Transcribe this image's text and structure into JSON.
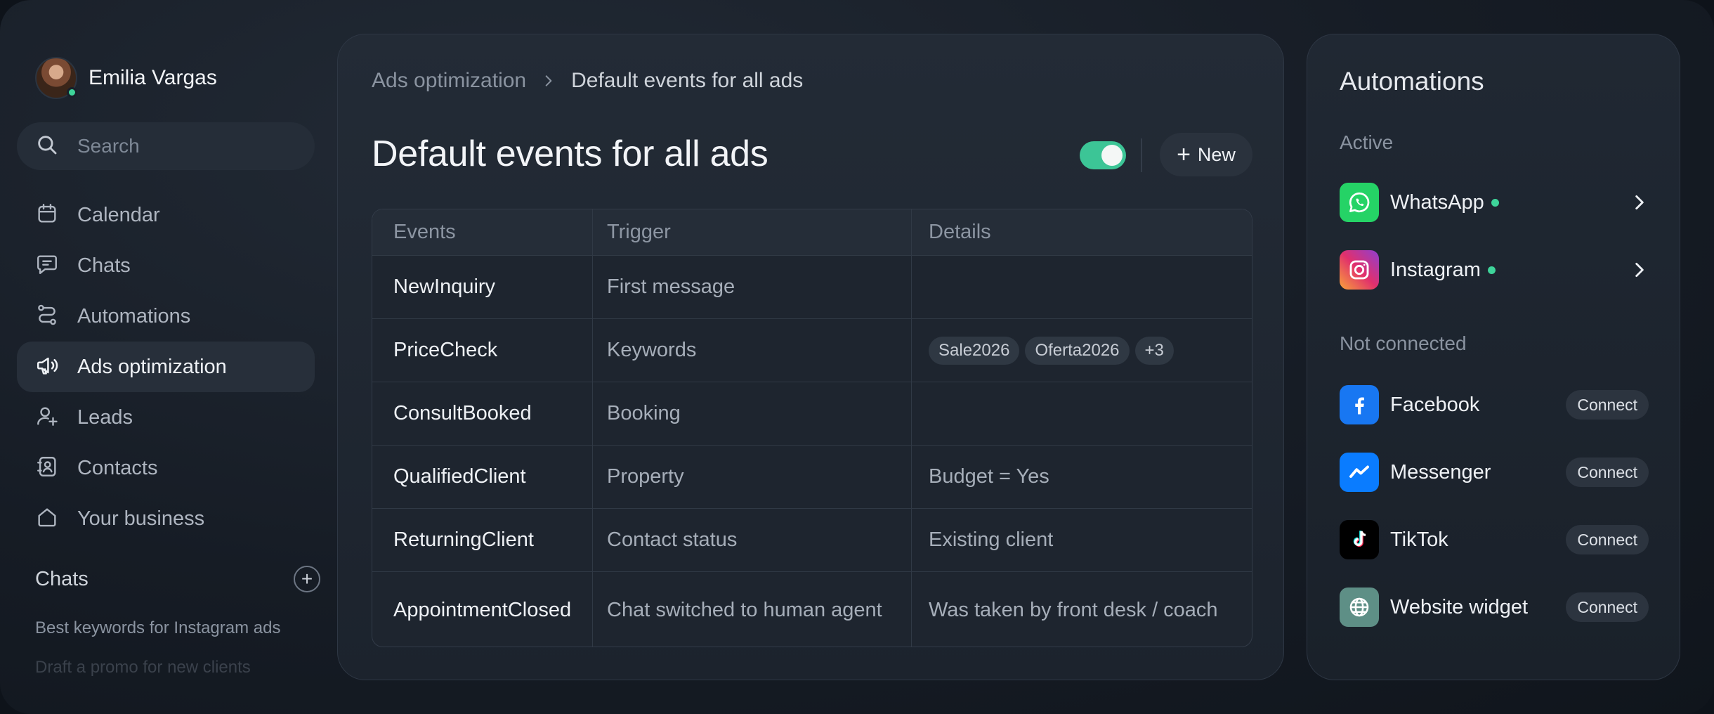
{
  "user": {
    "name": "Emilia Vargas"
  },
  "search": {
    "placeholder": "Search"
  },
  "nav": [
    {
      "label": "Calendar",
      "icon": "calendar-icon"
    },
    {
      "label": "Chats",
      "icon": "chat-icon"
    },
    {
      "label": "Automations",
      "icon": "automation-icon"
    },
    {
      "label": "Ads optimization",
      "icon": "megaphone-icon",
      "active": true
    },
    {
      "label": "Leads",
      "icon": "add-user-icon"
    },
    {
      "label": "Contacts",
      "icon": "contacts-icon"
    },
    {
      "label": "Your business",
      "icon": "home-icon"
    }
  ],
  "chats": {
    "title": "Chats",
    "items": [
      "Best keywords for Instagram ads",
      "Draft a promo for new clients"
    ]
  },
  "main": {
    "breadcrumb": [
      "Ads optimization",
      "Default events for all ads"
    ],
    "title": "Default events for all ads",
    "toggle_on": true,
    "new_label": "New",
    "table": {
      "headers": [
        "Events",
        "Trigger",
        "Details"
      ],
      "rows": [
        {
          "event": "NewInquiry",
          "trigger": "First message",
          "details": ""
        },
        {
          "event": "PriceCheck",
          "trigger": "Keywords",
          "tags": [
            "Sale2026",
            "Oferta2026",
            "+3"
          ]
        },
        {
          "event": "ConsultBooked",
          "trigger": "Booking",
          "details": ""
        },
        {
          "event": "QualifiedClient",
          "trigger": "Property",
          "details": "Budget = Yes"
        },
        {
          "event": "ReturningClient",
          "trigger": "Contact status",
          "details": "Existing client"
        },
        {
          "event": "AppointmentClosed",
          "trigger": "Chat switched to human agent",
          "details": "Was taken by front desk / coach"
        }
      ]
    }
  },
  "automations": {
    "title": "Automations",
    "active_label": "Active",
    "active": [
      {
        "name": "WhatsApp",
        "icon": "whatsapp-icon",
        "color": "#25d366"
      },
      {
        "name": "Instagram",
        "icon": "instagram-icon",
        "color": "#e1306c"
      }
    ],
    "not_connected_label": "Not connected",
    "connect_label": "Connect",
    "not_connected": [
      {
        "name": "Facebook",
        "icon": "facebook-icon",
        "color": "#1877f2"
      },
      {
        "name": "Messenger",
        "icon": "messenger-icon",
        "color": "#0a7cff"
      },
      {
        "name": "TikTok",
        "icon": "tiktok-icon",
        "color": "#000000"
      },
      {
        "name": "Website widget",
        "icon": "globe-icon",
        "color": "#5e8f86"
      }
    ]
  },
  "colors": {
    "accent": "#3cc596",
    "online": "#3ed49a"
  }
}
